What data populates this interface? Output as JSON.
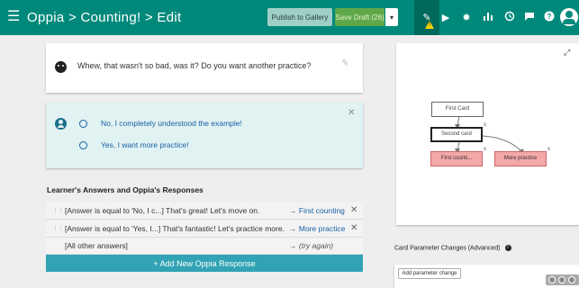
{
  "header": {
    "menu_icon": "hamburger-icon",
    "breadcrumb": "Oppia  >  Counting!  >  Edit",
    "publish_label": "Publish to Gallery",
    "save_draft_label": "Save Draft (26)",
    "nav_icons": [
      "pencil-icon",
      "play-icon",
      "gear-icon",
      "bar-chart-icon",
      "history-icon",
      "feedback-icon",
      "help-icon",
      "avatar-icon"
    ],
    "accent_color": "#00897b",
    "save_color": "#5ea84a"
  },
  "content": {
    "text": "Whew, that wasn't so bad, was it? Do you want another practice?"
  },
  "interaction": {
    "choices": [
      "No, I completely understood the example!",
      "Yes, I want more practice!"
    ]
  },
  "responses": {
    "title": "Learner's Answers and Oppia's Responses",
    "rows": [
      {
        "answer": "[Answer is equal to 'No, I c...] That's great! Let's move on.",
        "dest": "First counting"
      },
      {
        "answer": "[Answer is equal to 'Yes, I...] That's fantastic! Let's practice more.",
        "dest": "More practice"
      }
    ],
    "default_row": {
      "answer": "[All other answers]",
      "dest": "(try again)"
    },
    "add_label": "+ Add New Oppia Response",
    "add_color": "#31a3b4"
  },
  "graph": {
    "nodes": {
      "first_card": "First Card",
      "second_card": "Second card",
      "first_counting": "First counti...",
      "more_practice": "More practice"
    },
    "terminal_color": "#f4a8a8"
  },
  "params": {
    "title": "Card Parameter Changes (Advanced)",
    "add_label": "Add parameter change"
  }
}
